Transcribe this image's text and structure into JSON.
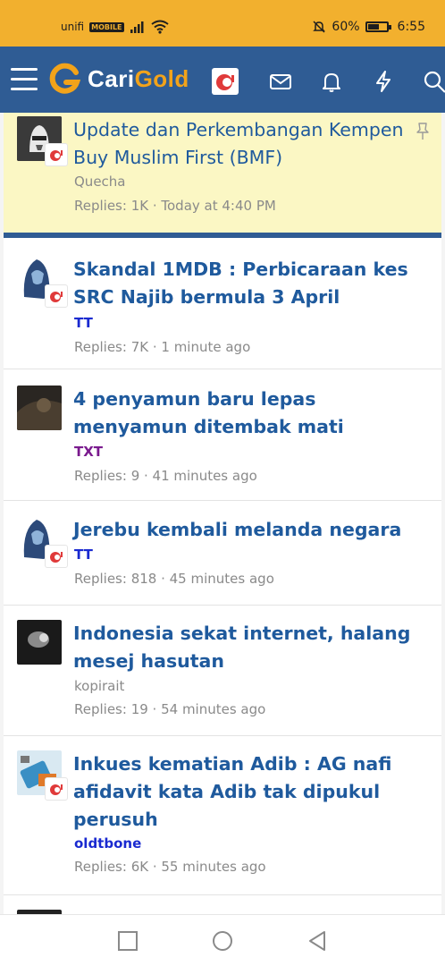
{
  "status_bar": {
    "carrier": "unifi",
    "carrier_badge": "MOBILE",
    "battery_text": "60%",
    "battery_level": 0.6,
    "time": "6:55"
  },
  "header": {
    "logo_cari": "Cari",
    "logo_gold": "Gold",
    "background_color": "#2f5c94",
    "accent_color": "#f2a31a",
    "icons": [
      "menu-icon",
      "avatar",
      "mail-icon",
      "bell-icon",
      "lightning-icon",
      "search-icon"
    ]
  },
  "threads": [
    {
      "title": "Update dan Perkembangan Kempen Buy Muslim First (BMF)",
      "author": "Quecha",
      "replies": "Replies: 1K",
      "time": "Today at 4:40 PM",
      "meta": "Replies: 1K · Today at 4:40 PM",
      "sticky": true
    },
    {
      "title": "Skandal 1MDB : Perbicaraan kes SRC Najib bermula 3 April",
      "author": "TT",
      "meta": "Replies: 7K · 1 minute ago"
    },
    {
      "title": "4 penyamun baru lepas menyamun ditembak mati",
      "author": "TXT",
      "meta": "Replies: 9 · 41 minutes ago"
    },
    {
      "title": "Jerebu kembali melanda negara",
      "author": "TT",
      "meta": "Replies: 818 · 45 minutes ago"
    },
    {
      "title": "Indonesia sekat internet, halang mesej hasutan",
      "author": "kopirait",
      "meta": "Replies: 19 · 54 minutes ago"
    },
    {
      "title": "Inkues kematian Adib : AG nafi afidavit kata Adib tak dipukul perusuh",
      "author": "oldtbone",
      "meta": "Replies: 6K · 55 minutes ago"
    }
  ],
  "colors": {
    "author_blue": "#1a2ad0",
    "author_purple": "#7a1a8e",
    "author_gray": "#8a8a8a",
    "link_blue": "#1f5a9d",
    "sticky_bg": "#fbf7c4"
  },
  "nav": {
    "buttons": [
      "recent-apps-button",
      "home-button",
      "back-button"
    ]
  }
}
